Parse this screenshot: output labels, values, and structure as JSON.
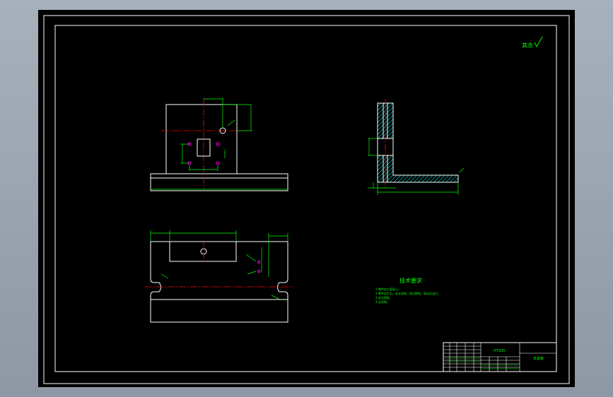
{
  "colors": {
    "background": "#000000",
    "outer_bg": "#9aa3ae",
    "geometry": "#ffffff",
    "dimension": "#00ff00",
    "centerline": "#ff0000",
    "hatch": "#00ffff",
    "hole": "#ff00ff"
  },
  "roughness_note": {
    "label": "其余",
    "symbol": "√"
  },
  "tech_requirements": {
    "title": "技术要求",
    "items": [
      "1.零件加工表面上。",
      "2.零件加工后，应去毛刺，锐边倒钝，清洁无油污。",
      "3.未注倒角。",
      "4.去毛刺。"
    ]
  },
  "title_block": {
    "material": "HT200",
    "part_name": "支承板"
  }
}
